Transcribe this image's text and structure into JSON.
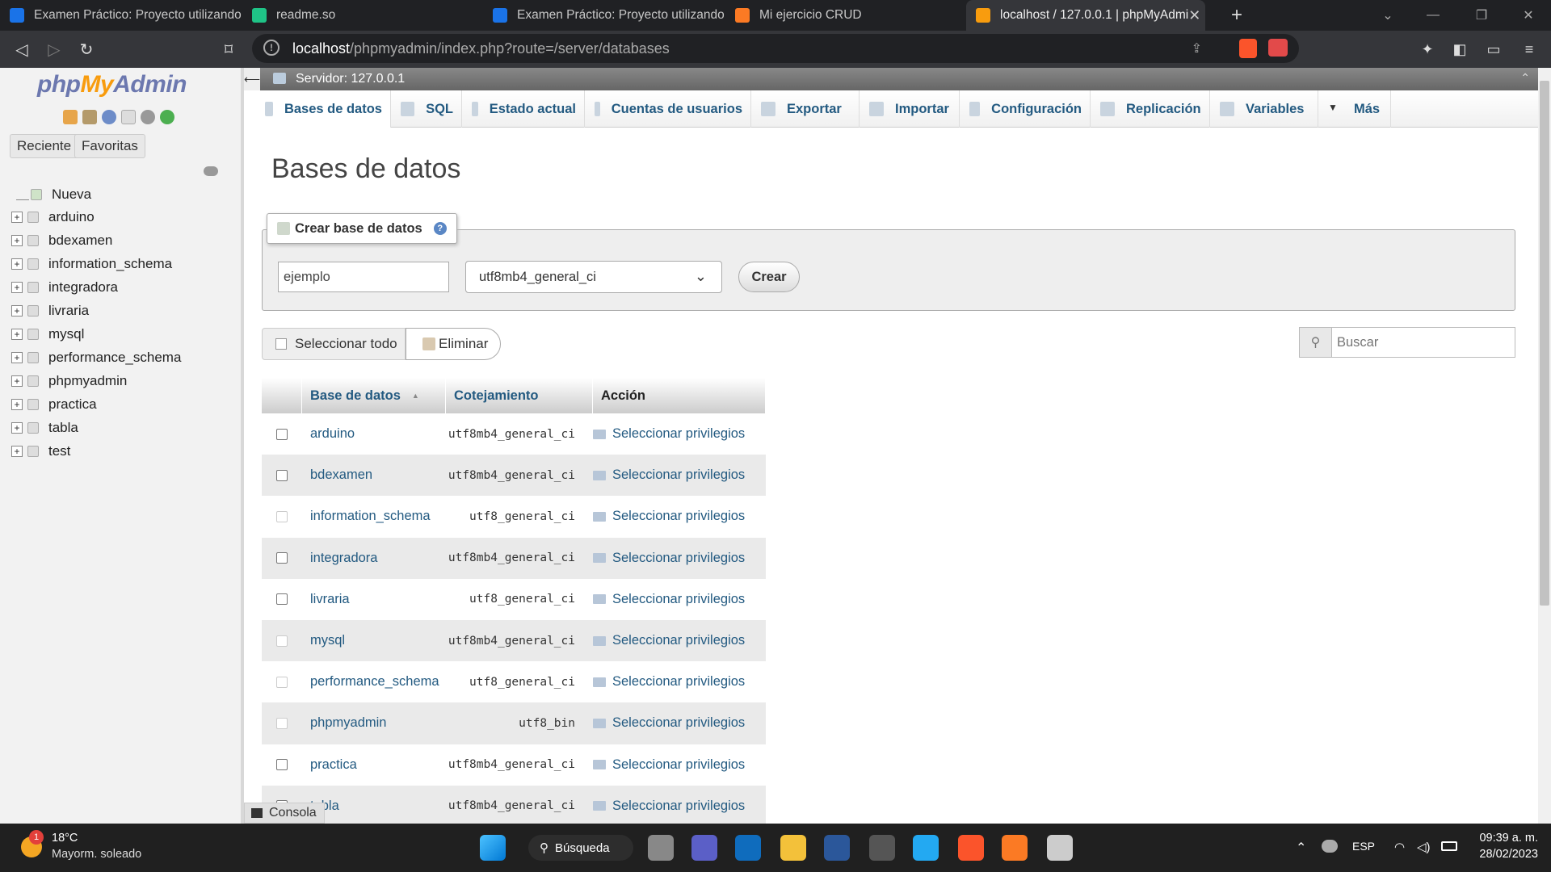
{
  "browser": {
    "tabs": [
      {
        "label": "Examen Práctico: Proyecto utilizando e",
        "icon": "classroom-icon",
        "color": "#1a73e8"
      },
      {
        "label": "readme.so",
        "icon": "readme-icon",
        "color": "#1fc487"
      },
      {
        "label": "Examen Práctico: Proyecto utilizando e",
        "icon": "classroom-icon",
        "color": "#1a73e8"
      },
      {
        "label": "Mi ejercicio CRUD",
        "icon": "xampp-icon",
        "color": "#fb7a24"
      },
      {
        "label": "localhost / 127.0.0.1 | phpMyAdmi",
        "icon": "phpmyadmin-icon",
        "color": "#f89c0e"
      }
    ],
    "new_tab": "+",
    "url_host": "localhost",
    "url_path": "/phpmyadmin/index.php?route=/server/databases"
  },
  "sidebar": {
    "logo_php": "php",
    "logo_my": "My",
    "logo_admin": "Admin",
    "recent_label": "Reciente",
    "favorites_label": "Favoritas",
    "new_label": "Nueva",
    "databases": [
      "arduino",
      "bdexamen",
      "information_schema",
      "integradora",
      "livraria",
      "mysql",
      "performance_schema",
      "phpmyadmin",
      "practica",
      "tabla",
      "test"
    ]
  },
  "server_bar": "Servidor: 127.0.0.1",
  "nav_tabs": [
    "Bases de datos",
    "SQL",
    "Estado actual",
    "Cuentas de usuarios",
    "Exportar",
    "Importar",
    "Configuración",
    "Replicación",
    "Variables",
    "Más"
  ],
  "page_title": "Bases de datos",
  "create": {
    "legend": "Crear base de datos",
    "name_value": "ejemplo",
    "collation_value": "utf8mb4_general_ci",
    "button": "Crear"
  },
  "select_all_label": "Seleccionar todo",
  "delete_label": "Eliminar",
  "search_placeholder": "Buscar",
  "table": {
    "headers": [
      "Base de datos",
      "Cotejamiento",
      "Acción"
    ],
    "rows": [
      {
        "name": "arduino",
        "collation": "utf8mb4_general_ci",
        "action": "Seleccionar privilegios",
        "checkbox_enabled": true
      },
      {
        "name": "bdexamen",
        "collation": "utf8mb4_general_ci",
        "action": "Seleccionar privilegios",
        "checkbox_enabled": true
      },
      {
        "name": "information_schema",
        "collation": "utf8_general_ci",
        "action": "Seleccionar privilegios",
        "checkbox_enabled": false
      },
      {
        "name": "integradora",
        "collation": "utf8mb4_general_ci",
        "action": "Seleccionar privilegios",
        "checkbox_enabled": true
      },
      {
        "name": "livraria",
        "collation": "utf8_general_ci",
        "action": "Seleccionar privilegios",
        "checkbox_enabled": true
      },
      {
        "name": "mysql",
        "collation": "utf8mb4_general_ci",
        "action": "Seleccionar privilegios",
        "checkbox_enabled": false
      },
      {
        "name": "performance_schema",
        "collation": "utf8_general_ci",
        "action": "Seleccionar privilegios",
        "checkbox_enabled": false
      },
      {
        "name": "phpmyadmin",
        "collation": "utf8_bin",
        "action": "Seleccionar privilegios",
        "checkbox_enabled": false
      },
      {
        "name": "practica",
        "collation": "utf8mb4_general_ci",
        "action": "Seleccionar privilegios",
        "checkbox_enabled": true
      },
      {
        "name": "tabla",
        "collation": "utf8mb4_general_ci",
        "action": "Seleccionar privilegios",
        "checkbox_enabled": true
      }
    ]
  },
  "console_label": "Consola",
  "taskbar": {
    "weather_temp": "18°C",
    "weather_desc": "Mayorm. soleado",
    "weather_badge": "1",
    "search_label": "Búsqueda",
    "language": "ESP",
    "time": "09:39 a. m.",
    "date": "28/02/2023"
  },
  "colors": {
    "link": "#235a81",
    "logo_blue": "#6c78af",
    "logo_orange": "#f89c0e"
  }
}
